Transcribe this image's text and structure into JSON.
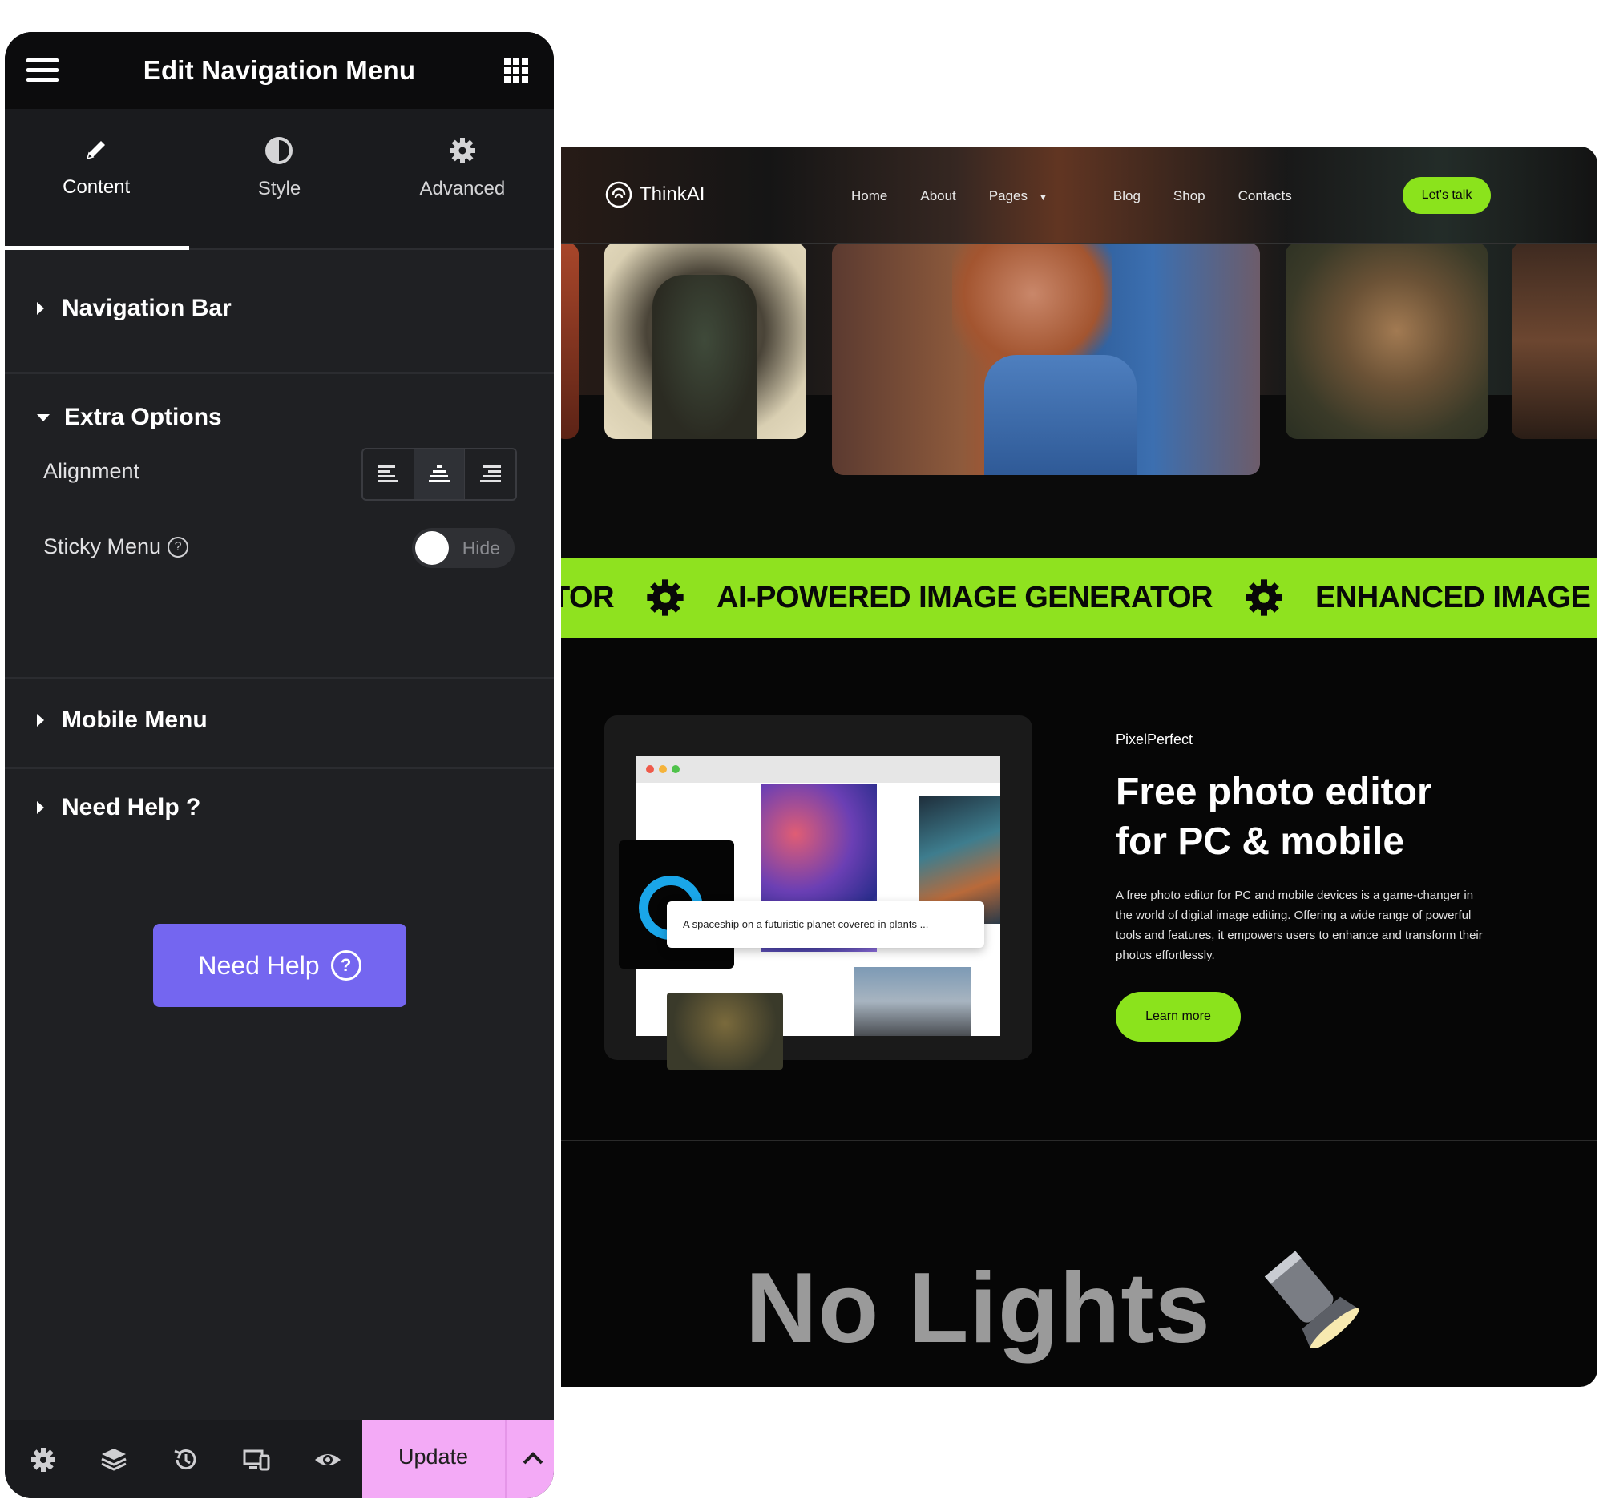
{
  "editor": {
    "title": "Edit Navigation Menu",
    "tabs": [
      {
        "label": "Content",
        "icon": "pencil-icon",
        "active": true
      },
      {
        "label": "Style",
        "icon": "half-circle-icon",
        "active": false
      },
      {
        "label": "Advanced",
        "icon": "gear-icon",
        "active": false
      }
    ],
    "sections": {
      "navigation_bar": "Navigation Bar",
      "extra_options": "Extra Options",
      "mobile_menu": "Mobile Menu",
      "need_help": "Need Help ?"
    },
    "controls": {
      "alignment_label": "Alignment",
      "alignment_selected": "center",
      "sticky_label": "Sticky Menu",
      "sticky_help": "?",
      "sticky_toggle": "Hide"
    },
    "need_help_button": "Need Help",
    "need_help_icon": "?",
    "footer": {
      "icons": [
        "settings-icon",
        "layers-icon",
        "history-icon",
        "responsive-icon",
        "preview-eye-icon"
      ],
      "update_label": "Update"
    }
  },
  "site": {
    "brand": "ThinkAI",
    "nav": [
      "Home",
      "About",
      "Pages",
      "Blog",
      "Shop",
      "Contacts"
    ],
    "cta": "Let's talk",
    "ticker": [
      "TOR",
      "AI-POWERED IMAGE GENERATOR",
      "ENHANCED IMAGE"
    ],
    "mock_prompt": "A spaceship on a futuristic planet covered in plants ...",
    "eyebrow": "PixelPerfect",
    "headline_line1": "Free photo editor",
    "headline_line2": "for PC & mobile",
    "paragraph": "A free photo editor for PC and mobile devices is a game-changer in the world of digital image editing. Offering a wide range of powerful tools and features, it empowers users to enhance and transform their photos effortlessly.",
    "learn_more": "Learn more",
    "no_lights": "No Lights"
  },
  "colors": {
    "panel_bg": "#1f2023",
    "header_bg": "#0c0c0d",
    "accent_purple": "#7466f0",
    "update_pink": "#f3aaf6",
    "lime": "#8be31c",
    "site_bg": "#060606"
  }
}
